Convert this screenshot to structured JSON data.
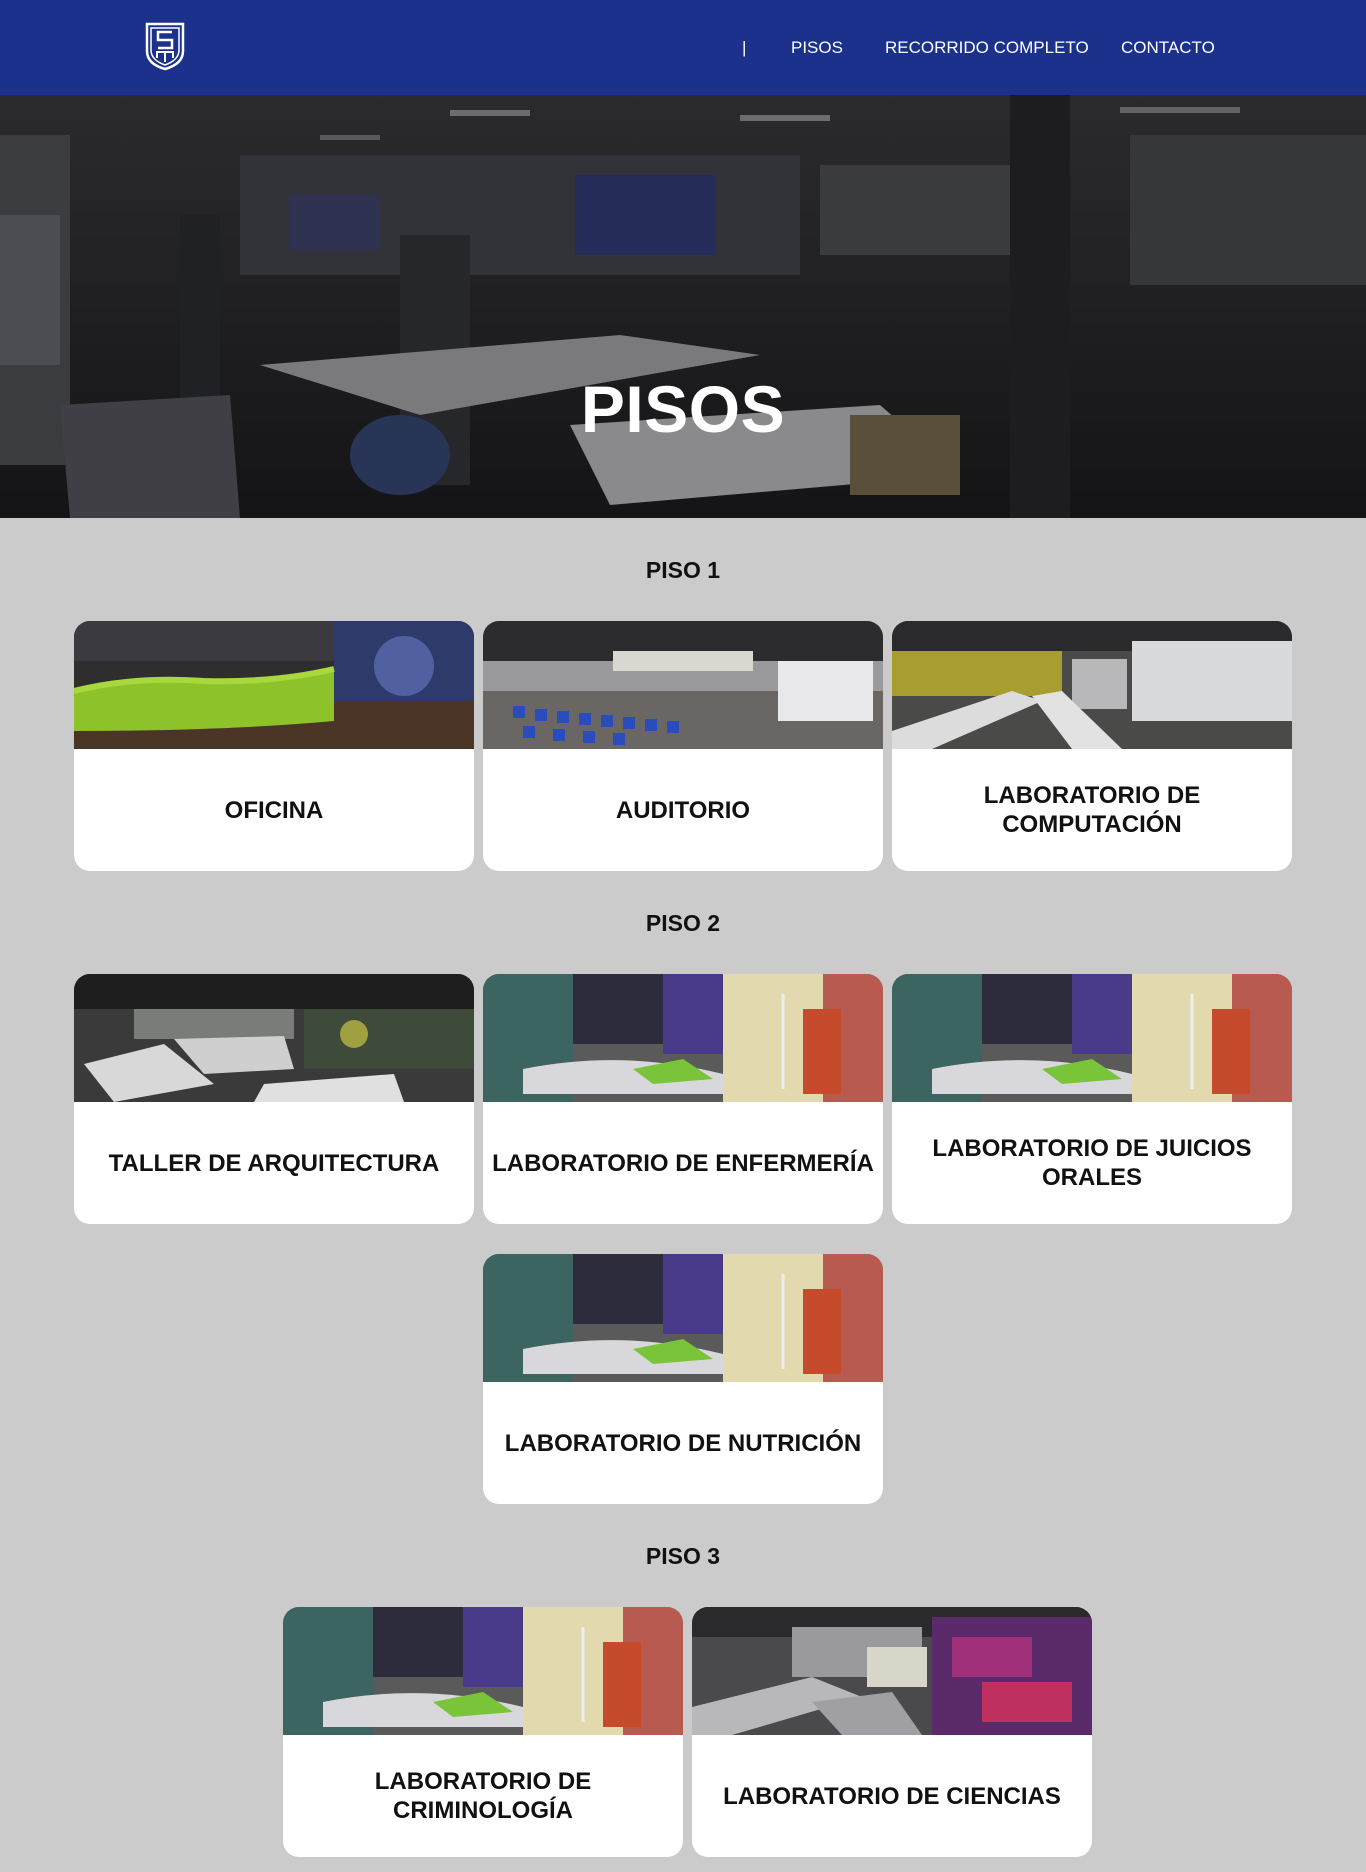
{
  "header": {
    "logo_icon": "shield-logo-icon",
    "separator": "|",
    "nav": {
      "pisos": "PISOS",
      "recorrido": "RECORRIDO COMPLETO",
      "contacto": "CONTACTO"
    },
    "colors": {
      "bar": "#1b318c",
      "text": "#ffffff"
    }
  },
  "hero": {
    "title": "PISOS"
  },
  "floors": [
    {
      "title": "PISO 1",
      "rooms": [
        {
          "label": "OFICINA"
        },
        {
          "label": "AUDITORIO"
        },
        {
          "label": "LABORATORIO DE COMPUTACIÓN"
        }
      ]
    },
    {
      "title": "PISO 2",
      "rooms": [
        {
          "label": "TALLER DE ARQUITECTURA"
        },
        {
          "label": "LABORATORIO DE ENFERMERÍA"
        },
        {
          "label": "LABORATORIO DE JUICIOS ORALES"
        },
        {
          "label": "LABORATORIO DE NUTRICIÓN"
        }
      ]
    },
    {
      "title": "PISO 3",
      "rooms": [
        {
          "label": "LABORATORIO DE CRIMINOLOGÍA"
        },
        {
          "label": "LABORATORIO DE CIENCIAS"
        }
      ]
    }
  ],
  "colors": {
    "page_bg": "#cbcbcb",
    "card_bg": "#ffffff"
  }
}
